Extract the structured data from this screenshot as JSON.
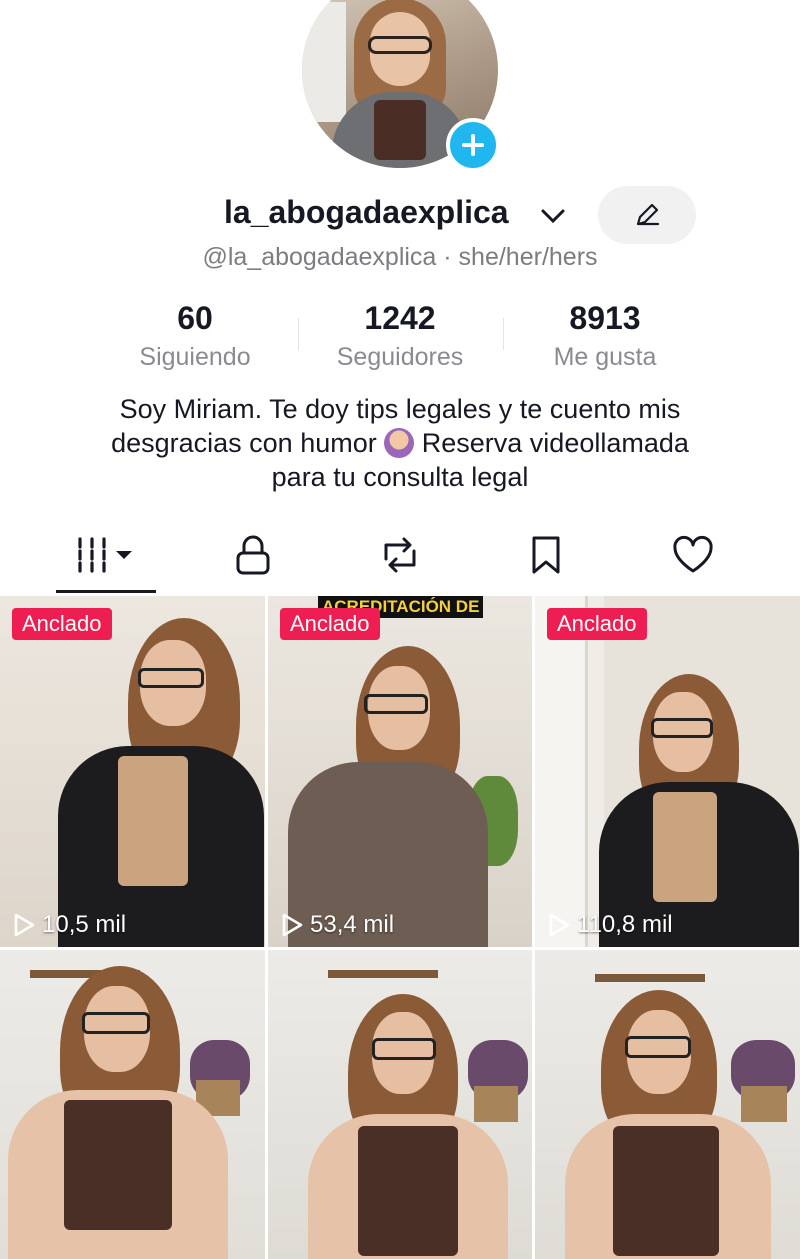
{
  "profile": {
    "username": "la_abogadaexplica",
    "handle": "@la_abogadaexplica · she/her/hers"
  },
  "stats": [
    {
      "value": "60",
      "label": "Siguiendo"
    },
    {
      "value": "1242",
      "label": "Seguidores"
    },
    {
      "value": "8913",
      "label": "Me gusta"
    }
  ],
  "bio": {
    "line1": "Soy Miriam. Te doy tips legales y te cuento mis",
    "line2a": "desgracias con humor",
    "line2b": "Reserva videollamada",
    "line3": "para tu consulta legal"
  },
  "tabs": [
    {
      "icon": "videos-grid-icon",
      "active": true
    },
    {
      "icon": "lock-icon"
    },
    {
      "icon": "repost-icon"
    },
    {
      "icon": "bookmark-icon"
    },
    {
      "icon": "heart-icon"
    }
  ],
  "videos": [
    {
      "pinned_label": "Anclado",
      "views": "10,5 mil"
    },
    {
      "pinned_label": "Anclado",
      "views": "53,4 mil",
      "caption": "ACREDITACIÓN DE"
    },
    {
      "pinned_label": "Anclado",
      "views": "110,8 mil"
    },
    {},
    {},
    {}
  ],
  "colors": {
    "accent": "#ee1d52",
    "plus": "#20b7f0",
    "text": "#161823",
    "muted": "#8a8b91"
  }
}
